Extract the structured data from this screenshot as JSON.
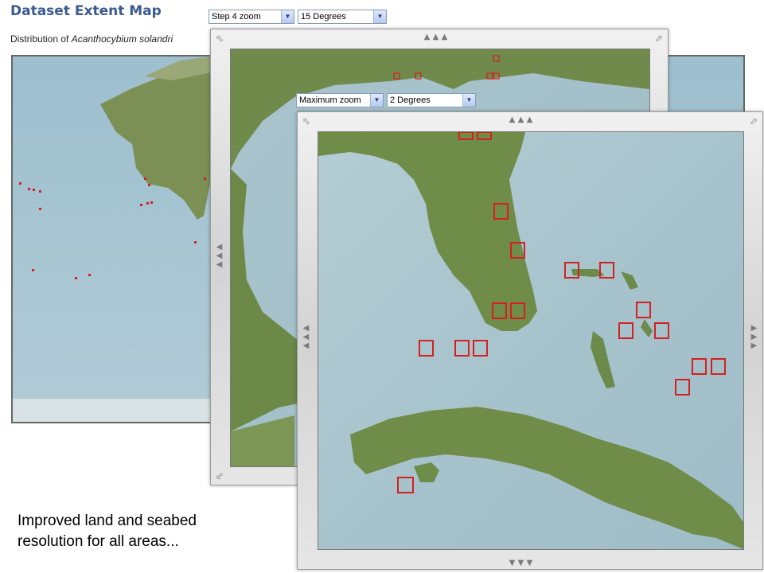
{
  "page": {
    "title": "Dataset Extent Map",
    "subtitle_prefix": "Distribution of ",
    "species": "Acanthocybium solandri"
  },
  "viewer_step4": {
    "zoom_select": "Step 4 zoom",
    "degree_select": "15 Degrees"
  },
  "viewer_max": {
    "zoom_select": "Maximum zoom",
    "degree_select": "2 Degrees"
  },
  "caption": {
    "line1": "Improved land and seabed",
    "line2": "resolution for all areas..."
  },
  "colors": {
    "title": "#3a5a92",
    "marker": "#d42020",
    "ocean": "#a8c6d3",
    "land": "#6f8f48"
  },
  "icons": {
    "corner": "diagonal-arrow-icon",
    "pan": "pan-arrows-icon"
  }
}
